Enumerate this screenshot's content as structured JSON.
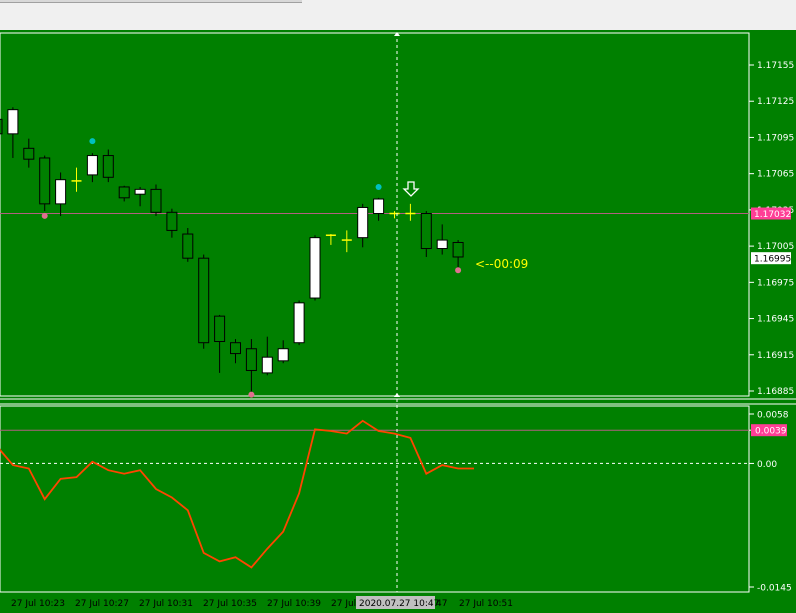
{
  "colors": {
    "background": "#008000",
    "frame": "#ffffff",
    "bull_candle": "#ffffff",
    "bear_candle": "#000000",
    "doji": "#ffff00",
    "fractal_up": "#00c0c0",
    "fractal_down": "#e07090",
    "bid_line": "#b06080",
    "oscillator": "#ff4500",
    "countdown": "#ffff00",
    "price_tag_bid": "#ff3e96",
    "price_tag_close": "#ffffff"
  },
  "countdown_label": "<--00:09",
  "arrow_marker_icon": "down-arrow-icon",
  "crosshair_time_label": "2020.07.27 10:47",
  "time_labels": [
    "27 Jul 10:23",
    "27 Jul 10:27",
    "27 Jul 10:31",
    "27 Jul 10:35",
    "27 Jul 10:39",
    "27 Jul 10:43",
    "27 Jul 10:47",
    "27 Jul 10:51"
  ],
  "chart_data": [
    {
      "type": "candlestick",
      "price_axis_labels": [
        "1.17155",
        "1.17125",
        "1.17095",
        "1.17065",
        "1.17035",
        "1.17005",
        "1.16975",
        "1.16945",
        "1.16915",
        "1.16885"
      ],
      "ylim": [
        1.1688,
        1.17185
      ],
      "bid_price": "1.17032",
      "last_price": "1.16995",
      "candles": [
        {
          "t": "10:22",
          "o": 1.1711,
          "h": 1.1712,
          "l": 1.17095,
          "c": 1.17098
        },
        {
          "t": "10:23",
          "o": 1.17098,
          "h": 1.1712,
          "l": 1.17078,
          "c": 1.17118
        },
        {
          "t": "10:24",
          "o": 1.17086,
          "h": 1.17094,
          "l": 1.1707,
          "c": 1.17077
        },
        {
          "t": "10:25",
          "o": 1.17078,
          "h": 1.1708,
          "l": 1.17034,
          "c": 1.1704
        },
        {
          "t": "10:26",
          "o": 1.1704,
          "h": 1.17066,
          "l": 1.1703,
          "c": 1.1706
        },
        {
          "t": "10:27",
          "o": 1.17059,
          "h": 1.1707,
          "l": 1.1705,
          "c": 1.1706
        },
        {
          "t": "10:28",
          "o": 1.17064,
          "h": 1.17082,
          "l": 1.17058,
          "c": 1.1708
        },
        {
          "t": "10:29",
          "o": 1.1708,
          "h": 1.17085,
          "l": 1.17058,
          "c": 1.17062
        },
        {
          "t": "10:30",
          "o": 1.17054,
          "h": 1.17055,
          "l": 1.17042,
          "c": 1.17045
        },
        {
          "t": "10:31",
          "o": 1.17048,
          "h": 1.17054,
          "l": 1.17038,
          "c": 1.17052
        },
        {
          "t": "10:32",
          "o": 1.17052,
          "h": 1.17056,
          "l": 1.1703,
          "c": 1.17033
        },
        {
          "t": "10:33",
          "o": 1.17033,
          "h": 1.17036,
          "l": 1.17012,
          "c": 1.17018
        },
        {
          "t": "10:34",
          "o": 1.17015,
          "h": 1.1702,
          "l": 1.16992,
          "c": 1.16995
        },
        {
          "t": "10:35",
          "o": 1.16995,
          "h": 1.16998,
          "l": 1.1692,
          "c": 1.16925
        },
        {
          "t": "10:36",
          "o": 1.16947,
          "h": 1.16948,
          "l": 1.169,
          "c": 1.16926
        },
        {
          "t": "10:37",
          "o": 1.16925,
          "h": 1.16928,
          "l": 1.16908,
          "c": 1.16916
        },
        {
          "t": "10:38",
          "o": 1.1692,
          "h": 1.16928,
          "l": 1.16882,
          "c": 1.16902
        },
        {
          "t": "10:39",
          "o": 1.169,
          "h": 1.1693,
          "l": 1.16898,
          "c": 1.16913
        },
        {
          "t": "10:40",
          "o": 1.1691,
          "h": 1.16927,
          "l": 1.16908,
          "c": 1.1692
        },
        {
          "t": "10:41",
          "o": 1.16925,
          "h": 1.1696,
          "l": 1.16923,
          "c": 1.16958
        },
        {
          "t": "10:42",
          "o": 1.16962,
          "h": 1.17014,
          "l": 1.1696,
          "c": 1.17012
        },
        {
          "t": "10:43",
          "o": 1.17014,
          "h": 1.17015,
          "l": 1.17006,
          "c": 1.17012
        },
        {
          "t": "10:44",
          "o": 1.1701,
          "h": 1.17018,
          "l": 1.17,
          "c": 1.1701
        },
        {
          "t": "10:45",
          "o": 1.17012,
          "h": 1.1704,
          "l": 1.17004,
          "c": 1.17037
        },
        {
          "t": "10:46",
          "o": 1.17032,
          "h": 1.17045,
          "l": 1.17026,
          "c": 1.17044
        },
        {
          "t": "10:47",
          "o": 1.17032,
          "h": 1.17034,
          "l": 1.17028,
          "c": 1.17032
        },
        {
          "t": "10:48",
          "o": 1.17032,
          "h": 1.1704,
          "l": 1.17026,
          "c": 1.17032
        },
        {
          "t": "10:49",
          "o": 1.17032,
          "h": 1.17034,
          "l": 1.16996,
          "c": 1.17003
        },
        {
          "t": "10:50",
          "o": 1.17003,
          "h": 1.17023,
          "l": 1.16998,
          "c": 1.1701
        },
        {
          "t": "10:51",
          "o": 1.17008,
          "h": 1.1701,
          "l": 1.16985,
          "c": 1.16996
        }
      ],
      "fractals_up": [
        {
          "t": "10:28",
          "y": 1.17092
        },
        {
          "t": "10:46",
          "y": 1.17054
        }
      ],
      "fractals_down": [
        {
          "t": "10:25",
          "y": 1.1703
        },
        {
          "t": "10:38",
          "y": 1.16882
        },
        {
          "t": "10:51",
          "y": 1.16985
        }
      ]
    },
    {
      "type": "line",
      "axis_labels": [
        "0.0058",
        "0.0039",
        "0.00",
        "-0.0145"
      ],
      "ylim": [
        -0.0148,
        0.0062
      ],
      "level_line": 0.0039,
      "zero_line": 0.0,
      "series": [
        {
          "x": [
            -1,
            0,
            1,
            2,
            3,
            4,
            5,
            6,
            7,
            8,
            9,
            10,
            11,
            12,
            13,
            14,
            15,
            16,
            17,
            18,
            19,
            20,
            21,
            22,
            23,
            24,
            25,
            26,
            27,
            28,
            29
          ],
          "values": [
            0.002,
            -0.0002,
            -0.0006,
            -0.0042,
            -0.0018,
            -0.0016,
            0.0002,
            -0.0008,
            -0.0012,
            -0.0008,
            -0.003,
            -0.004,
            -0.0055,
            -0.0105,
            -0.0115,
            -0.011,
            -0.0122,
            -0.01,
            -0.008,
            -0.0035,
            0.004,
            0.0038,
            0.0035,
            0.005,
            0.0038,
            0.0035,
            0.003,
            -0.0012,
            -0.0002,
            -0.0006,
            -0.0006
          ]
        }
      ]
    }
  ]
}
